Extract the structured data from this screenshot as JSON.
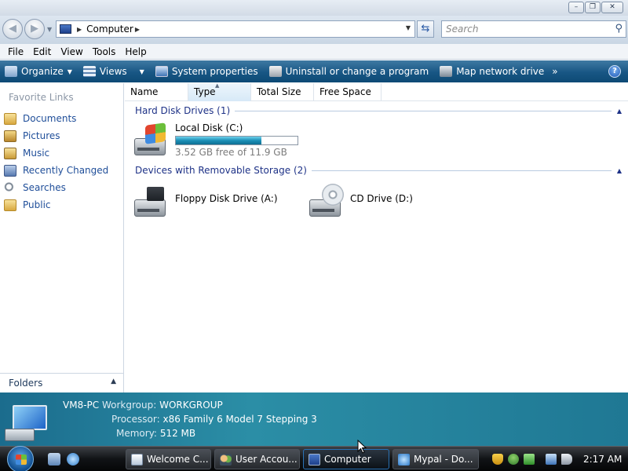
{
  "window": {
    "controls": {
      "minimize": "–",
      "maximize": "❐",
      "close": "✕"
    }
  },
  "address": {
    "location": "Computer",
    "search_placeholder": "Search"
  },
  "menu": [
    "File",
    "Edit",
    "View",
    "Tools",
    "Help"
  ],
  "toolbar": {
    "organize": "Organize",
    "views": "Views",
    "system_properties": "System properties",
    "uninstall": "Uninstall or change a program",
    "map_drive": "Map network drive",
    "more": "»",
    "help": "?"
  },
  "sidebar": {
    "heading": "Favorite Links",
    "items": [
      {
        "label": "Documents",
        "icon": "folder-icon"
      },
      {
        "label": "Pictures",
        "icon": "pictures-icon"
      },
      {
        "label": "Music",
        "icon": "music-icon"
      },
      {
        "label": "Recently Changed",
        "icon": "recent-icon"
      },
      {
        "label": "Searches",
        "icon": "search-icon"
      },
      {
        "label": "Public",
        "icon": "folder-icon"
      }
    ],
    "folders_label": "Folders"
  },
  "columns": [
    "Name",
    "Type",
    "Total Size",
    "Free Space"
  ],
  "groups": {
    "hard_disk": "Hard Disk Drives (1)",
    "removable": "Devices with Removable Storage (2)"
  },
  "drives": {
    "local": {
      "name": "Local Disk (C:)",
      "free_text": "3.52 GB free of 11.9 GB",
      "used_fraction": 0.704
    },
    "floppy": {
      "name": "Floppy Disk Drive (A:)"
    },
    "cd": {
      "name": "CD Drive (D:)"
    }
  },
  "details": {
    "computer_name": "VM8-PC",
    "workgroup_label": "Workgroup:",
    "workgroup": "WORKGROUP",
    "processor_label": "Processor:",
    "processor": "x86 Family 6 Model 7 Stepping 3",
    "memory_label": "Memory:",
    "memory": "512 MB"
  },
  "taskbar": {
    "buttons": [
      "Welcome C...",
      "User Accou...",
      "Computer",
      "Mypal - Do..."
    ],
    "clock": "2:17 AM"
  }
}
